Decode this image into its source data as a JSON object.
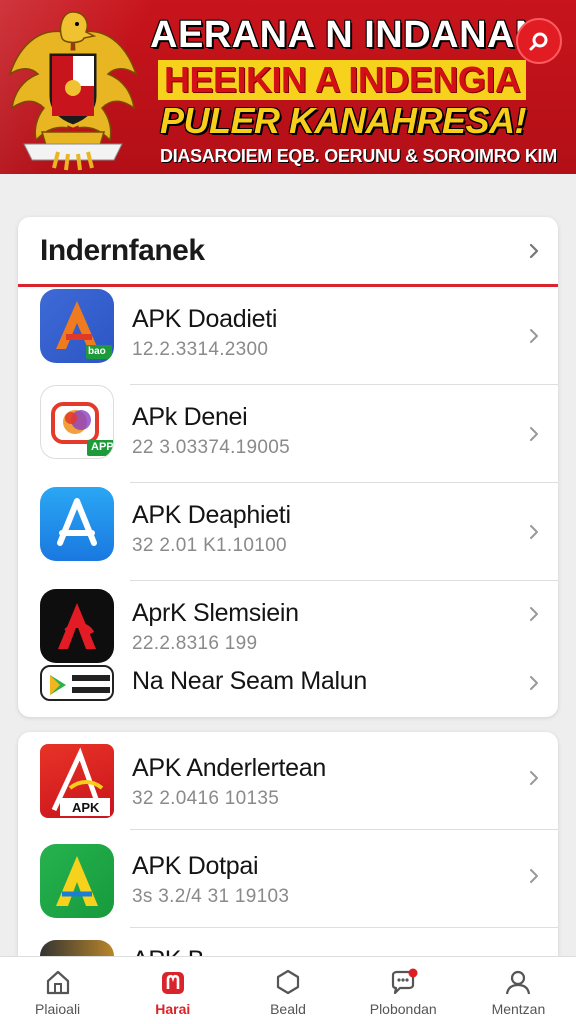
{
  "banner": {
    "line1": "AERANA N INDANAN",
    "line2": "HEEIKIN A INDENGIA",
    "line3": "PULER KANAHRESA!",
    "line4": "DIASAROIEM EQB. OERUNU & SOROIMRO KIM",
    "search_icon": "search-icon",
    "emblem": "garuda-emblem"
  },
  "colors": {
    "brand_red": "#c8141c",
    "accent_yellow": "#f6d21c",
    "divider_red": "#d8242a"
  },
  "section1": {
    "title": "Indernfanek",
    "items": [
      {
        "name": "APK Doadieti",
        "meta": "12.2.3314.2300",
        "icon": "letter-a-orange-blue-icon",
        "badge": "bao"
      },
      {
        "name": "APk Denei",
        "meta": "22 3.03374.19005",
        "icon": "colorful-camera-icon",
        "badge": "APP"
      },
      {
        "name": "APK Deaphieti",
        "meta": "32 2.01 K1.10100",
        "icon": "app-store-a-icon"
      },
      {
        "name": "AprK Slemsiein",
        "meta": "22.2.8316 199",
        "icon": "red-a-dark-icon"
      },
      {
        "name": "Na Near Seam Malun",
        "meta": "",
        "icon": "play-store-badge-icon"
      }
    ]
  },
  "section2": {
    "items": [
      {
        "name": "APK Anderlertean",
        "meta": "32 2.0416 10135",
        "icon": "red-apk-icon",
        "badge": "APK"
      },
      {
        "name": "APK Dotpai",
        "meta": "3s 3.2/4 31 19103",
        "icon": "green-a-icon"
      },
      {
        "name": "APK B",
        "meta": "",
        "icon": "gold-app-icon"
      }
    ]
  },
  "nav": [
    {
      "label": "Plaioali",
      "icon": "home-icon",
      "active": false
    },
    {
      "label": "Harai",
      "icon": "apps-icon",
      "active": true
    },
    {
      "label": "Beald",
      "icon": "hexagon-icon",
      "active": false
    },
    {
      "label": "Plobondan",
      "icon": "chat-icon",
      "active": false
    },
    {
      "label": "Mentzan",
      "icon": "user-icon",
      "active": false
    }
  ]
}
